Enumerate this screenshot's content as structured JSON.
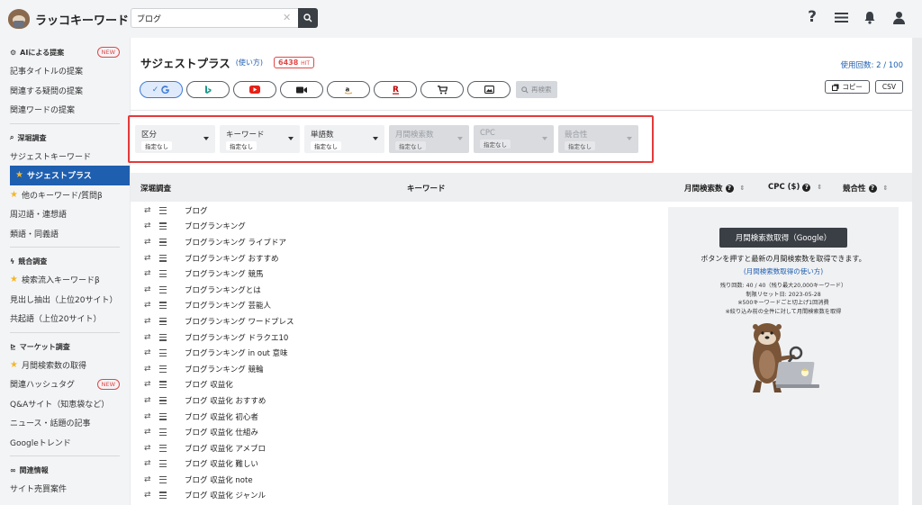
{
  "app": {
    "logo_text": "ラッコキーワード"
  },
  "search": {
    "value": "ブログ",
    "clear_glyph": "✕"
  },
  "sidebar": {
    "sections": [
      {
        "head": "AIによる提案",
        "badge": "NEW",
        "items": [
          "記事タイトルの提案",
          "関連する疑問の提案",
          "関連ワードの提案"
        ]
      },
      {
        "head": "深堀調査",
        "items": [
          "サジェストキーワード",
          "サジェストプラス",
          "他のキーワード/質問β",
          "周辺語・連想語",
          "類語・同義語"
        ]
      },
      {
        "head": "競合調査",
        "items": [
          "検索流入キーワードβ",
          "見出し抽出（上位20サイト）",
          "共起語（上位20サイト）"
        ]
      },
      {
        "head": "マーケット調査",
        "items": [
          "月間検索数の取得",
          "関連ハッシュタグ",
          "Q&Aサイト（知恵袋など）",
          "ニュース・話題の記事",
          "Googleトレンド"
        ]
      },
      {
        "head": "関連情報",
        "items": [
          "サイト売買案件"
        ]
      }
    ],
    "new_badge": "NEW"
  },
  "main": {
    "title": "サジェストプラス",
    "howto": "(使い方)",
    "hit_count": "6438",
    "hit_unit": "HIT",
    "usage": "使用回数: 2 / 100",
    "re_search": "再検索",
    "copy_label": "コピー",
    "csv_label": "CSV",
    "filters": [
      {
        "label": "区分",
        "value": "指定なし"
      },
      {
        "label": "キーワード",
        "value": "指定なし"
      },
      {
        "label": "単語数",
        "value": "指定なし"
      },
      {
        "label": "月間検索数",
        "value": "指定なし"
      },
      {
        "label": "CPC",
        "value": "指定なし"
      },
      {
        "label": "競合性",
        "value": "指定なし"
      }
    ],
    "columns": {
      "deep": "深堀調査",
      "keyword": "キーワード",
      "volume": "月間検索数",
      "cpc": "CPC ($)",
      "competition": "競合性"
    },
    "keywords": [
      "ブログ",
      "ブログランキング",
      "ブログランキング ライブドア",
      "ブログランキング おすすめ",
      "ブログランキング 競馬",
      "ブログランキングとは",
      "ブログランキング 芸能人",
      "ブログランキング ワードプレス",
      "ブログランキング ドラクエ10",
      "ブログランキング in out 意味",
      "ブログランキング 競輪",
      "ブログ 収益化",
      "ブログ 収益化 おすすめ",
      "ブログ 収益化 初心者",
      "ブログ 収益化 仕組み",
      "ブログ 収益化 アメブロ",
      "ブログ 収益化 難しい",
      "ブログ 収益化 note",
      "ブログ 収益化 ジャンル"
    ],
    "panel": {
      "button": "月間検索数取得（Google）",
      "message": "ボタンを押すと最新の月間検索数を取得できます。",
      "link": "(月間検索数取得の使い方)",
      "info": [
        "残り回数: 40 / 40（残り最大20,000キーワード）",
        "制限リセット日: 2023-05-28",
        "※500キーワードごと切上げ1回消費",
        "※絞り込み前の全件に対して月間検索数を取得"
      ]
    }
  },
  "colors": {
    "accent": "#1f5fb0",
    "danger": "#e53a3a",
    "dark": "#3a3f45"
  },
  "icons": {
    "sources": [
      "google-icon",
      "bing-icon",
      "youtube-icon",
      "video-icon",
      "amazon-icon",
      "rakuten-icon",
      "shopping-cart-icon",
      "image-icon"
    ]
  }
}
